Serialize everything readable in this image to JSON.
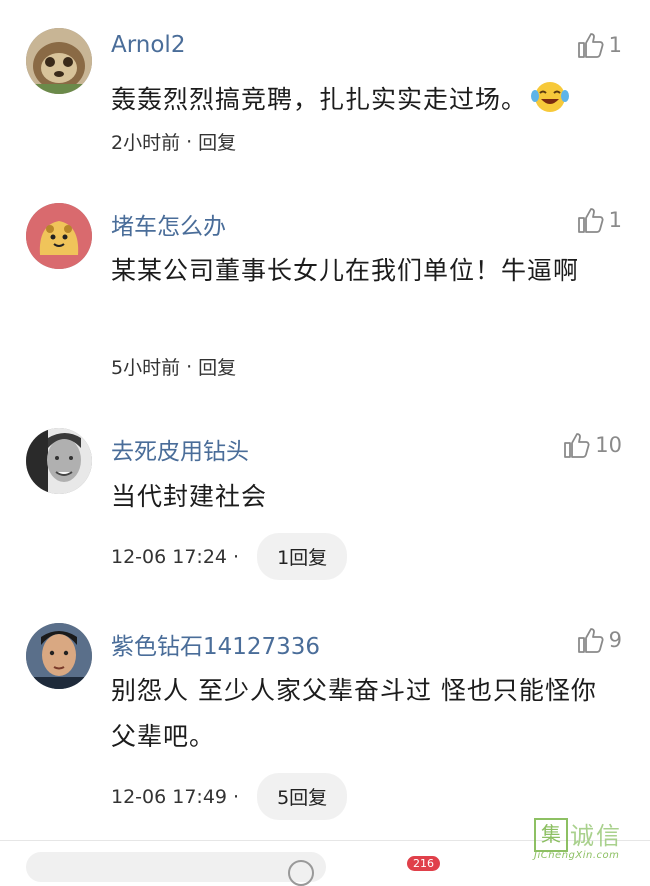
{
  "comments": [
    {
      "username": "Arnol2",
      "likes": "1",
      "text": "轰轰烈烈搞竞聘，扎扎实实走过场。",
      "time": "2小时前",
      "dot": "·",
      "reply": "回复",
      "emoji": "laughing-crying-emoji"
    },
    {
      "username": "堵车怎么办",
      "likes": "1",
      "text": "某某公司董事长女儿在我们单位！牛逼啊",
      "time": "5小时前",
      "dot": "·",
      "reply": "回复"
    },
    {
      "username": "去死皮用钻头",
      "likes": "10",
      "text": "当代封建社会",
      "time": "12-06 17:24",
      "dot": "·",
      "reply": "1回复"
    },
    {
      "username": "紫色钻石14127336",
      "likes": "9",
      "text": "别怨人 至少人家父辈奋斗过 怪也只能怪你父辈吧。",
      "time": "12-06 17:49",
      "dot": "·",
      "reply": "5回复"
    }
  ],
  "bottom_bar": {
    "badge": "216"
  },
  "watermark": {
    "box_char": "集",
    "text": "诚信",
    "url": "JiChengXin.com"
  },
  "colors": {
    "username": "#4a6d99",
    "like": "#8a8a8a",
    "badge": "#e0404a"
  }
}
